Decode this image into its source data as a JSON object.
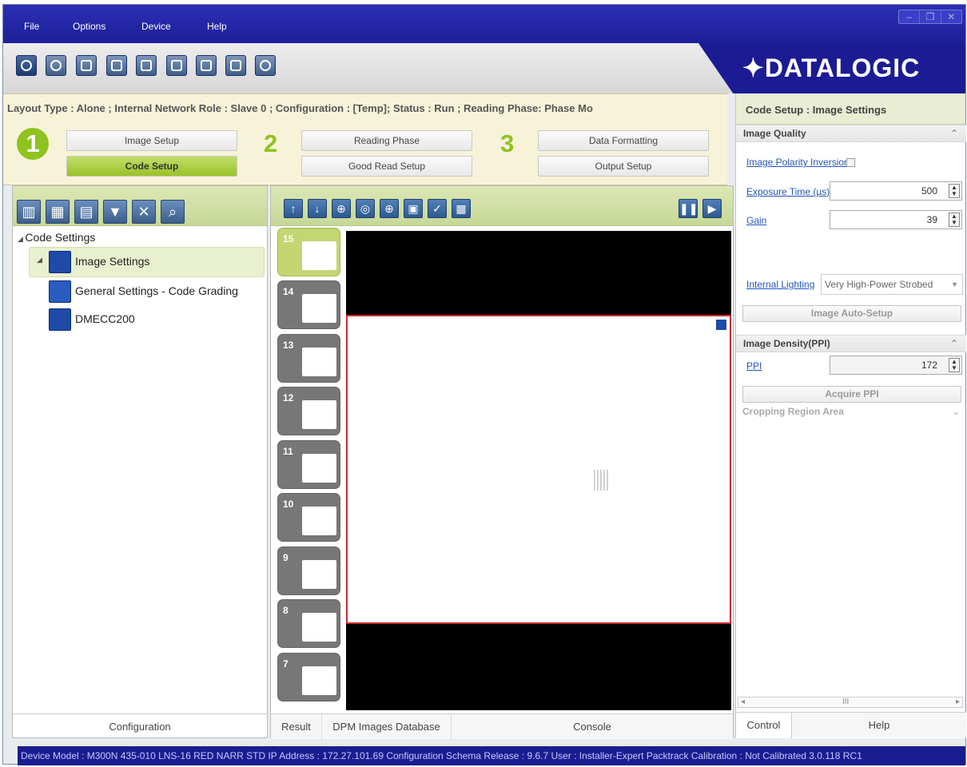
{
  "menu": {
    "file": "File",
    "options": "Options",
    "device": "Device",
    "help": "Help"
  },
  "brand": {
    "logo": "✦DATALOGIC",
    "color": "#1b1c93",
    "accent": "#8fc31f"
  },
  "layout_info": "Layout Type : Alone ; Internal Network Role : Slave 0 ; Configuration : [Temp]; Status : Run ; Reading Phase: Phase Mo",
  "steps": {
    "one": "1",
    "two": "2",
    "three": "3",
    "image_setup": "Image Setup",
    "code_setup": "Code Setup",
    "reading_phase": "Reading Phase",
    "good_read_setup": "Good Read Setup",
    "data_formatting": "Data Formatting",
    "output_setup": "Output Setup"
  },
  "right_panel": {
    "title": "Code Setup : Image Settings",
    "image_quality": "Image Quality",
    "polarity_inversion": "Image Polarity Inversion",
    "exposure_time_label": "Exposure Time (µs)",
    "exposure_time": "500",
    "gain_label": "Gain",
    "gain": "39",
    "internal_lighting_label": "Internal Lighting",
    "internal_lighting_value": "Very High-Power Strobed",
    "image_auto_setup": "Image Auto-Setup",
    "image_density": "Image Density(PPI)",
    "ppi_label": "PPI",
    "ppi": "172",
    "acquire_ppi": "Acquire PPI",
    "cropping_region": "Cropping Region Area",
    "scroll_mark": "III",
    "tab_control": "Control",
    "tab_help": "Help"
  },
  "tree": {
    "root": "Code Settings",
    "image_settings": "Image Settings",
    "general_settings": "General Settings - Code Grading",
    "dmecc200": "DMECC200",
    "tab": "Configuration"
  },
  "thumbnails": [
    "15",
    "14",
    "13",
    "12",
    "11",
    "10",
    "9",
    "8",
    "7"
  ],
  "center_tabs": {
    "result": "Result",
    "dpm": "DPM Images Database",
    "console": "Console"
  },
  "status_bar": "Device Model : M300N 435-010 LNS-16 RED NARR STD   IP Address : 172.27.101.69   Configuration Schema Release : 9.6.7   User : Installer-Expert   Packtrack Calibration : Not Calibrated  3.0.118 RC1"
}
